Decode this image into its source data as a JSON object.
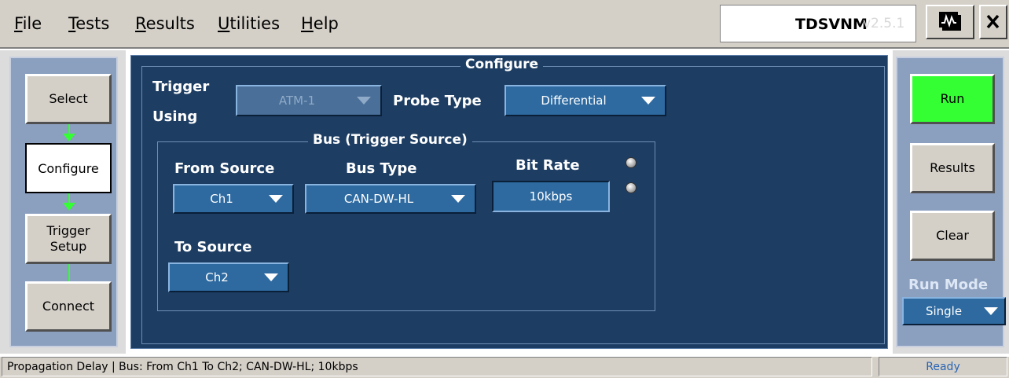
{
  "menu": {
    "items": [
      "File",
      "Tests",
      "Results",
      "Utilities",
      "Help"
    ],
    "app_title": "TDSVNM",
    "app_version": "v2.5.1"
  },
  "nav": {
    "select": "Select",
    "configure": "Configure",
    "trigger_setup_line1": "Trigger",
    "trigger_setup_line2": "Setup",
    "connect": "Connect"
  },
  "configure": {
    "title": "Configure",
    "trigger_using_line1": "Trigger",
    "trigger_using_line2": "Using",
    "trigger_using_value": "ATM-1",
    "probe_type_label": "Probe Type",
    "probe_type_value": "Differential",
    "bus_group_title": "Bus (Trigger Source)",
    "from_source_label": "From Source",
    "from_source_value": "Ch1",
    "bus_type_label": "Bus Type",
    "bus_type_value": "CAN-DW-HL",
    "bit_rate_label": "Bit Rate",
    "bit_rate_value": "10kbps",
    "to_source_label": "To Source",
    "to_source_value": "Ch2"
  },
  "actions": {
    "run": "Run",
    "results": "Results",
    "clear": "Clear",
    "run_mode_label": "Run Mode",
    "run_mode_value": "Single"
  },
  "status": {
    "message": "Propagation Delay  |  Bus: From Ch1 To Ch2; CAN-DW-HL; 10kbps",
    "state": "Ready"
  },
  "colors": {
    "panel_bg": "#1d3d63",
    "run_button": "#33ff33",
    "connector_arrow": "#33ff33",
    "dropdown_bg": "#2e6aa0"
  }
}
